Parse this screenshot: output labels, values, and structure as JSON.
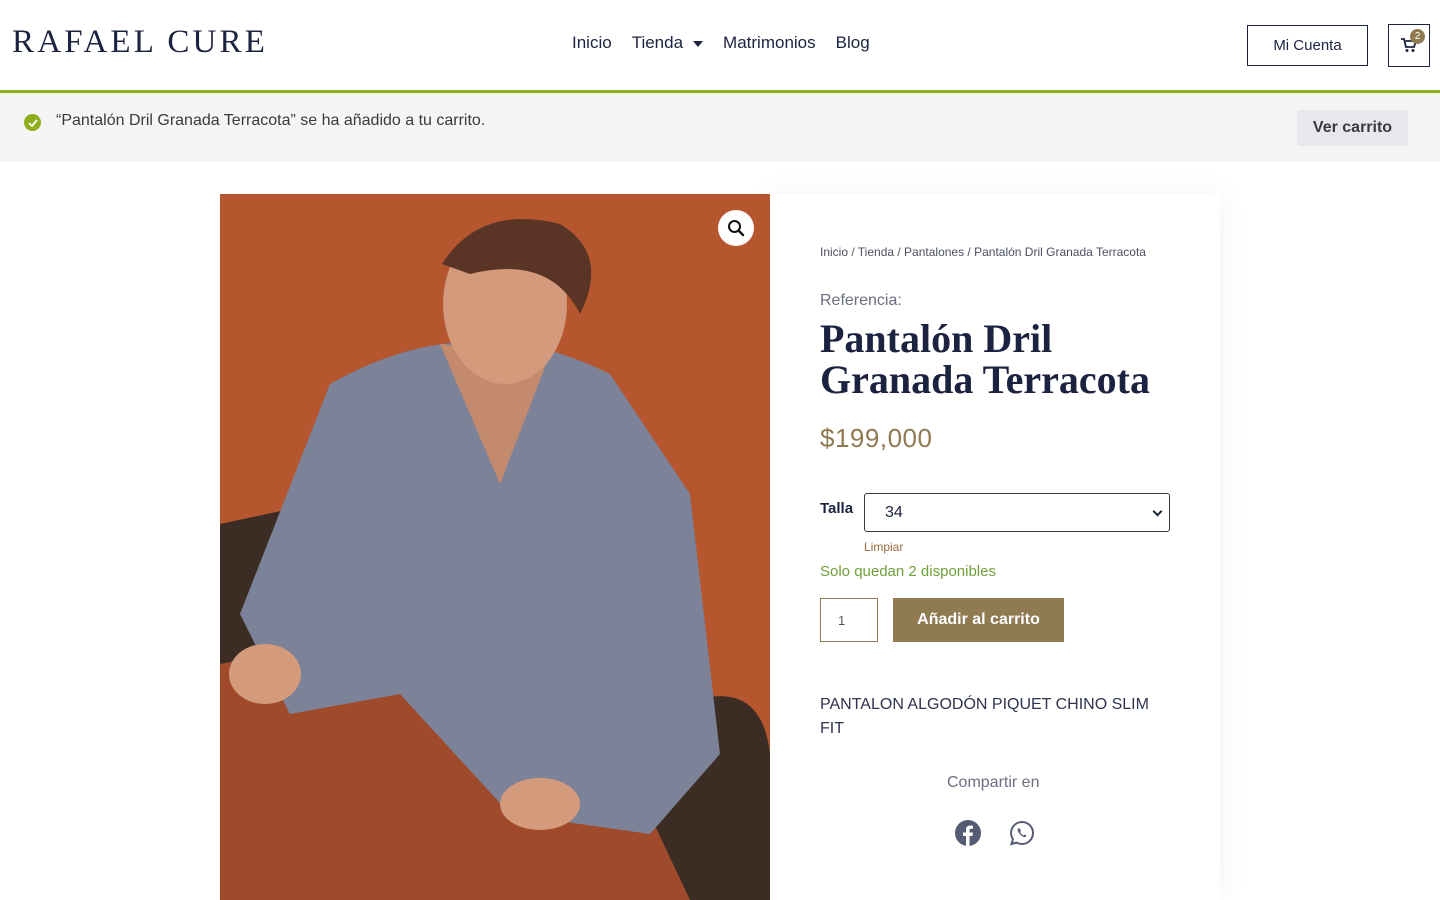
{
  "header": {
    "logo": "RAFAEL CURE",
    "nav": [
      "Inicio",
      "Tienda",
      "Matrimonios",
      "Blog"
    ],
    "account_label": "Mi Cuenta",
    "cart_count": "2"
  },
  "notice": {
    "message": "“Pantalón Dril Granada Terracota” se ha añadido a tu carrito.",
    "view_cart_label": "Ver carrito"
  },
  "product": {
    "breadcrumb": "Inicio / Tienda / Pantalones / Pantalón Dril Granada Terracota",
    "reference_label": "Referencia:",
    "title": "Pantalón Dril Granada Terracota",
    "price": "$199,000",
    "size_label": "Talla",
    "size_selected": "34",
    "clear_label": "Limpiar",
    "stock_text": "Solo quedan 2 disponibles",
    "quantity": "1",
    "add_to_cart_label": "Añadir al carrito",
    "description": "PANTALON ALGODÓN PIQUET CHINO SLIM FIT",
    "share_label": "Compartir en"
  },
  "colors": {
    "brand_navy": "#1c2340",
    "accent_gold": "#8f7a52",
    "success_green": "#8fae1b",
    "stock_green": "#6ea03a",
    "photo_background": "#b5562f"
  },
  "icons": [
    "caret-down-icon",
    "cart-icon",
    "check-circle-icon",
    "zoom-icon",
    "facebook-icon",
    "whatsapp-icon"
  ]
}
